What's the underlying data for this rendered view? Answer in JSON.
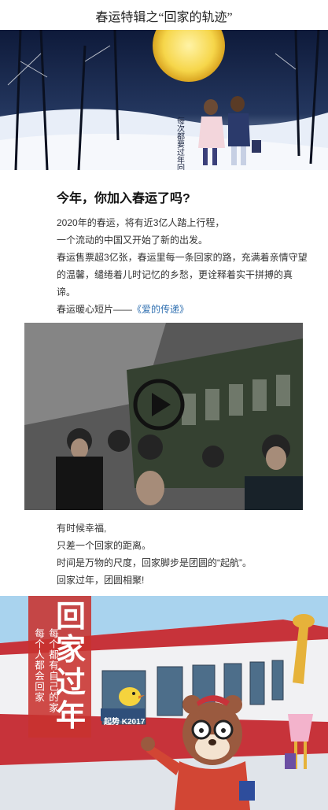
{
  "page": {
    "title": "春运特辑之“回家的轨迹”"
  },
  "hero": {
    "calligraphy": "每次都要过年回家"
  },
  "article": {
    "headline": "今年，你加入春运了吗?",
    "p1": "2020年的春运，将有近3亿人踏上行程，",
    "p2": "一个流动的中国又开始了新的出发。",
    "p3": "春运售票超3亿张，春运里每一条回家的路，充满着亲情守望的温馨，缱绻着儿时记忆的乡愁，更诠释着实干拼搏的真谛。",
    "p4_prefix": "春运暖心短片——",
    "p4_link": "《爱的传递》"
  },
  "video": {
    "play_icon": "play-icon"
  },
  "closing": {
    "l1": "有时候幸福,",
    "l2": "只差一个回家的距离。",
    "l3": "时间是万物的尺度，回家脚步是团圆的“起航”。",
    "l4": "回家过年，团圆相聚!"
  },
  "poster": {
    "big": "回家过年",
    "sub1": "每个都有自己的家",
    "sub2": "每个人都会回家",
    "plate": "起势 K2017"
  },
  "colors": {
    "accent_red": "#c8322f",
    "link_blue": "#2f6fb0",
    "sky": "#a9d3ee"
  }
}
